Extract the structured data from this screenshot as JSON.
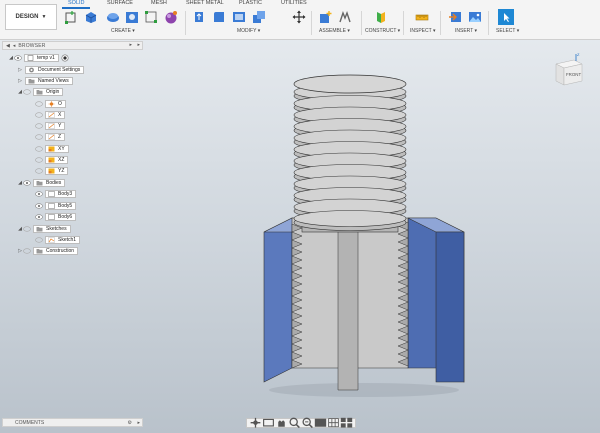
{
  "toolbar": {
    "workspace": "DESIGN",
    "tabs": [
      {
        "label": "SOLID",
        "active": true
      },
      {
        "label": "SURFACE",
        "active": false
      },
      {
        "label": "MESH",
        "active": false
      },
      {
        "label": "SHEET METAL",
        "active": false
      },
      {
        "label": "PLASTIC",
        "active": false
      },
      {
        "label": "UTILITIES",
        "active": false
      }
    ],
    "groups": {
      "create": "CREATE ▾",
      "modify": "MODIFY ▾",
      "assemble": "ASSEMBLE ▾",
      "construct": "CONSTRUCT ▾",
      "inspect": "INSPECT ▾",
      "insert": "INSERT ▾",
      "select": "SELECT ▾"
    }
  },
  "browser": {
    "title": "BROWSER",
    "nodes": {
      "root": "temp v1",
      "document_settings": "Document Settings",
      "named_views": "Named Views",
      "origin": "Origin",
      "o": "O",
      "x": "X",
      "y": "Y",
      "z": "Z",
      "xy": "XY",
      "xz": "XZ",
      "yz": "YZ",
      "bodies": "Bodies",
      "body3": "Body3",
      "body5": "Body5",
      "body6": "Body6",
      "sketches": "Sketches",
      "sketch1": "Sketch1",
      "construction": "Construction"
    }
  },
  "comments": {
    "title": "COMMENTS"
  },
  "viewcube": {
    "face": "FRONT",
    "axis_z": "Z"
  },
  "colors": {
    "accent": "#1f6fc5",
    "body_blue": "#4f6fb3",
    "body_grey": "#c3c3c3",
    "viewport_top": "#e9edf1",
    "viewport_bottom": "#b9c2cb"
  },
  "icons": {
    "create": [
      "sketch-icon",
      "extrude-icon",
      "revolve-icon",
      "hole-icon",
      "line-icon",
      "form-icon"
    ],
    "modify": [
      "press-pull-icon",
      "fillet-icon",
      "shell-icon",
      "combine-icon",
      "move-icon"
    ],
    "assemble": [
      "new-component-icon",
      "joint-icon"
    ],
    "construct": [
      "plane-icon"
    ],
    "inspect": [
      "measure-icon"
    ],
    "insert": [
      "insert-derive-icon",
      "insert-image-icon"
    ],
    "select": [
      "select-arrow-icon"
    ]
  }
}
